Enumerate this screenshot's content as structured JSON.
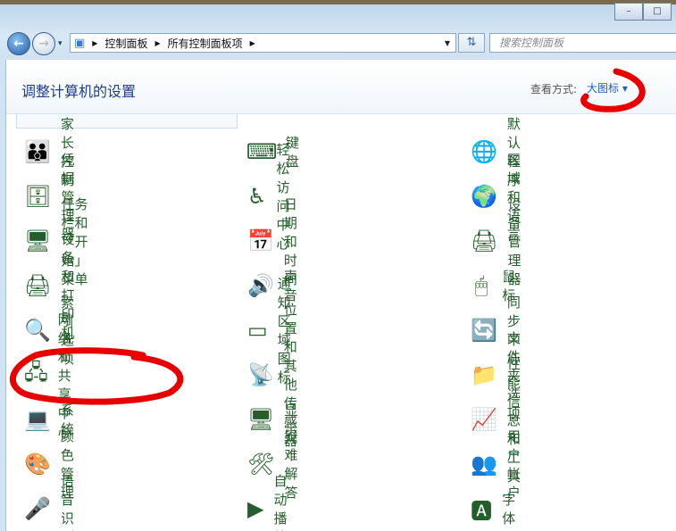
{
  "window": {
    "minimize": "–",
    "maximize": "□"
  },
  "nav": {
    "back": "←",
    "forward": "→",
    "dropdown": "▾"
  },
  "breadcrumb": [
    "控制面板",
    "所有控制面板项"
  ],
  "search": {
    "placeholder": "搜索控制面板"
  },
  "header": {
    "title": "调整计算机的设置",
    "view_label": "查看方式:",
    "view_value": "大图标 ▾"
  },
  "items": [
    {
      "label": "家长控制",
      "icon": "👪"
    },
    {
      "label": "键盘",
      "icon": "⌨"
    },
    {
      "label": "默认程序",
      "icon": "🌐"
    },
    {
      "label": "凭据管理器",
      "icon": "🗄"
    },
    {
      "label": "轻松访问中心",
      "icon": "♿"
    },
    {
      "label": "区域和语言",
      "icon": "🌍"
    },
    {
      "label": "任务栏和「开始」菜单",
      "icon": "🖥"
    },
    {
      "label": "日期和时间",
      "icon": "📅"
    },
    {
      "label": "设备管理器",
      "icon": "🖨"
    },
    {
      "label": "设备和打印机",
      "icon": "🖨"
    },
    {
      "label": "声音",
      "icon": "🔊"
    },
    {
      "label": "鼠标",
      "icon": "🖱"
    },
    {
      "label": "索引选项",
      "icon": "🔍"
    },
    {
      "label": "通知区域图标",
      "icon": "▭"
    },
    {
      "label": "同步中心",
      "icon": "🔄"
    },
    {
      "label": "网络和共享中心",
      "icon": "🖧"
    },
    {
      "label": "位置和其他传感器",
      "icon": "📡"
    },
    {
      "label": "文件夹选项",
      "icon": "📁"
    },
    {
      "label": "系统",
      "icon": "💻"
    },
    {
      "label": "显示",
      "icon": "🖥"
    },
    {
      "label": "性能信息和工具",
      "icon": "📈"
    },
    {
      "label": "颜色管理",
      "icon": "🎨"
    },
    {
      "label": "疑难解答",
      "icon": "🛠"
    },
    {
      "label": "用户帐户",
      "icon": "👥"
    },
    {
      "label": "语音识别",
      "icon": "🎤"
    },
    {
      "label": "自动播放",
      "icon": "▶"
    },
    {
      "label": "字体",
      "icon": "🅰"
    }
  ]
}
